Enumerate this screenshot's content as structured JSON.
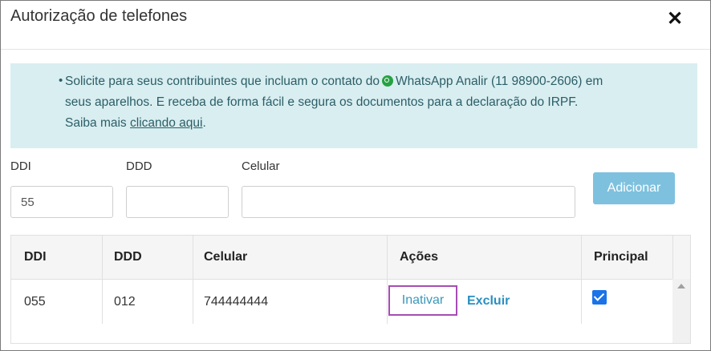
{
  "modal": {
    "title": "Autorização de telefones",
    "close_label": "✕"
  },
  "info": {
    "bullet": "•",
    "text_before_icon": "Solicite para seus contribuintes que incluam o contato do",
    "text_after_icon": "WhatsApp Analir (11 98900-2606) em",
    "line2": "seus aparelhos. E receba de forma fácil e segura os documentos para a declaração do IRPF.",
    "line3_prefix": "Saiba mais",
    "link_label": "clicando aqui",
    "line3_suffix": ".",
    "icon": "whatsapp-icon",
    "background_color": "#d9eef0"
  },
  "form": {
    "ddi_label": "DDI",
    "ddi_value": "55",
    "ddd_label": "DDD",
    "ddd_value": "",
    "celular_label": "Celular",
    "celular_value": "",
    "add_button_label": "Adicionar",
    "add_button_color": "#7ec1de"
  },
  "table": {
    "columns": [
      "DDI",
      "DDD",
      "Celular",
      "Ações",
      "Principal"
    ],
    "rows": [
      {
        "ddi": "055",
        "ddd": "012",
        "celular": "744444444",
        "action_inativar": "Inativar",
        "action_excluir": "Excluir",
        "principal": true
      }
    ]
  }
}
